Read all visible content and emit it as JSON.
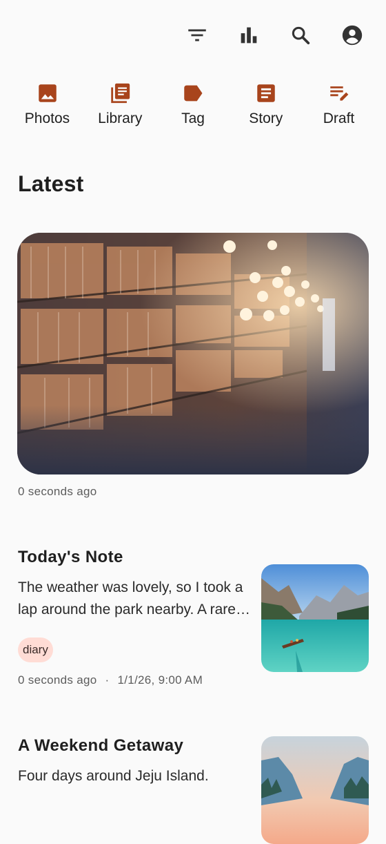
{
  "toolbar": {
    "icons": [
      "filter-icon",
      "bar-chart-icon",
      "search-icon",
      "account-icon"
    ]
  },
  "categories": [
    {
      "label": "Photos",
      "icon": "photo-icon"
    },
    {
      "label": "Library",
      "icon": "library-icon"
    },
    {
      "label": "Tag",
      "icon": "tag-icon"
    },
    {
      "label": "Story",
      "icon": "story-icon"
    },
    {
      "label": "Draft",
      "icon": "draft-icon"
    }
  ],
  "colors": {
    "accent": "#a8441c",
    "chip_bg": "#ffdcd5",
    "background": "#fafafa"
  },
  "latest": {
    "title": "Latest",
    "hero_time": "0 seconds ago"
  },
  "notes": [
    {
      "title": "Today's Note",
      "body": "The weather was lovely, so I took a lap around the park nearby. A rare peaceful afternoon.",
      "tag": "diary",
      "time": "0 seconds ago",
      "separator": "·",
      "date": "1/1/26, 9:00 AM",
      "thumb": "lake-photo"
    },
    {
      "title": "A Weekend Getaway",
      "body": "Four days around Jeju Island.",
      "thumb": "mountain-photo"
    }
  ]
}
